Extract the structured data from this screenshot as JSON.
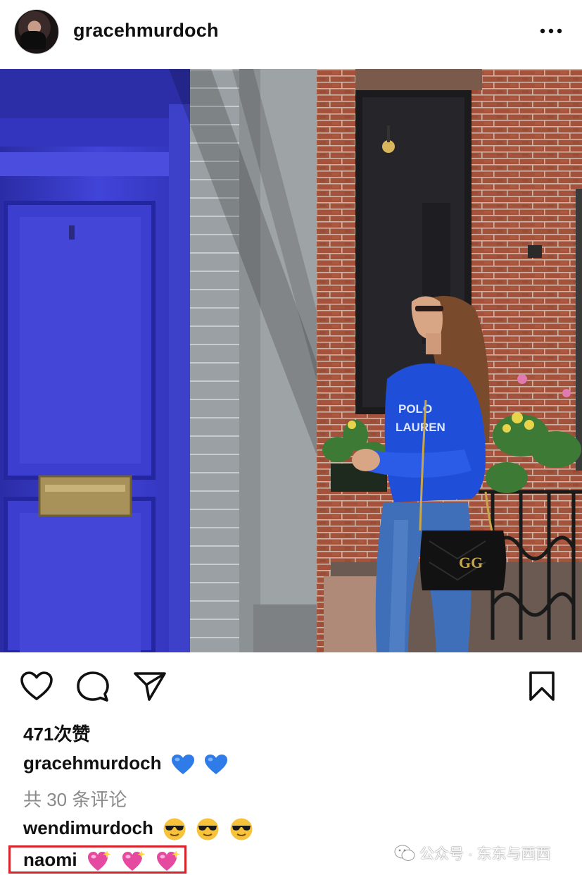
{
  "post": {
    "username": "gracehmurdoch",
    "likes_text": "471次赞",
    "caption_user": "gracehmurdoch",
    "caption_emojis": [
      "blue-heart",
      "blue-heart"
    ],
    "comments_link": "共 30 条评论",
    "comments": [
      {
        "user": "wendimurdoch",
        "emojis": [
          "sunglasses-face",
          "sunglasses-face",
          "sunglasses-face"
        ]
      },
      {
        "user": "naomi",
        "emojis": [
          "sparkling-heart",
          "sparkling-heart",
          "sparkling-heart"
        ]
      }
    ]
  },
  "watermark": {
    "text": "公众号 · 东东与西西"
  },
  "colors": {
    "highlight_box": "#d8232a",
    "door_blue": "#3d3fcf",
    "brick": "#a4523b"
  }
}
